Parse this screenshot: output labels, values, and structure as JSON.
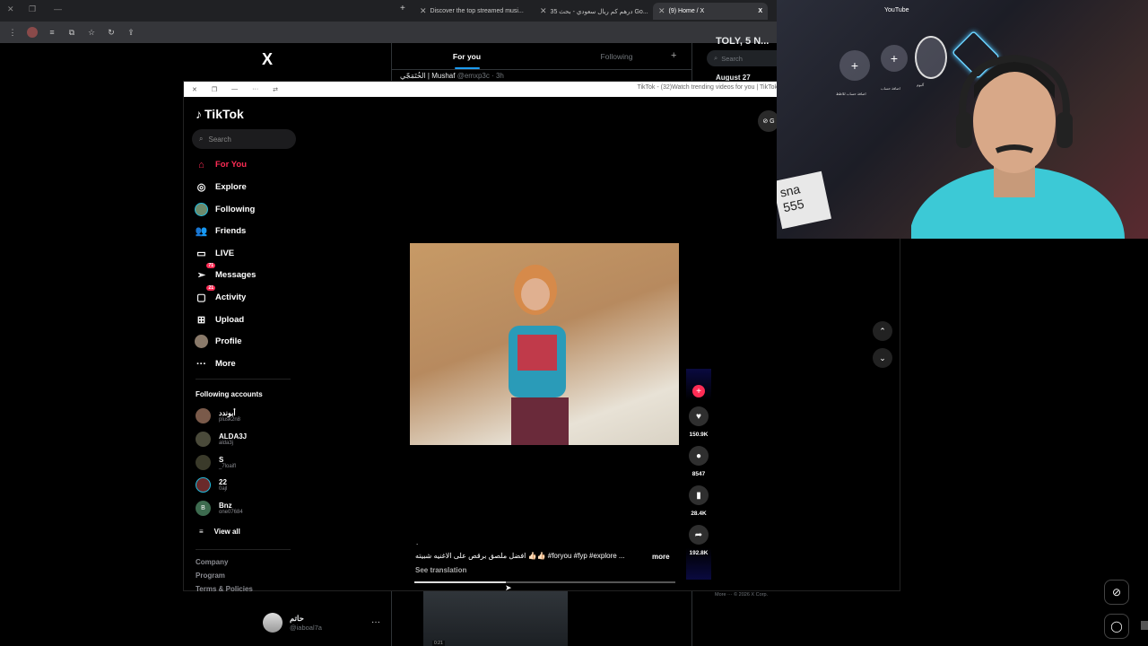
{
  "browser": {
    "tabs": [
      {
        "label": "Discover the top streamed musi...",
        "active": false
      },
      {
        "label": "35 ‎درهم كم ريال سعودي - بحث Go...",
        "active": false
      },
      {
        "label": "(9) Home / X",
        "active": true
      }
    ]
  },
  "x": {
    "logo": "X",
    "tab_for_you": "For you",
    "tab_following": "Following",
    "post_peek_name": "الخُتَمَجّي | Mushaf",
    "post_peek_meta": "@emxp3c · 3h",
    "search_placeholder": "Search",
    "trend_heading": "TOLY, 5 N...",
    "date_label": "August 27",
    "footer": "More ···   © 2026 X Corp.",
    "account_name": "حاتم",
    "account_handle": "@iaboal7a",
    "thumb_label": "0:21"
  },
  "tiktok": {
    "window_title": "TikTok - (32)Watch trending videos for you | TikTok",
    "logo": "TikTok",
    "search_placeholder": "Search",
    "nav": [
      {
        "label": "For You",
        "icon": "home-icon",
        "active": true
      },
      {
        "label": "Explore",
        "icon": "compass-icon"
      },
      {
        "label": "Following",
        "icon": "following-avatar-icon"
      },
      {
        "label": "Friends",
        "icon": "friends-icon"
      },
      {
        "label": "LIVE",
        "icon": "live-icon"
      },
      {
        "label": "Messages",
        "icon": "messages-icon",
        "badge": "71"
      },
      {
        "label": "Activity",
        "icon": "activity-icon",
        "badge": "21"
      },
      {
        "label": "Upload",
        "icon": "upload-icon"
      },
      {
        "label": "Profile",
        "icon": "profile-avatar-icon"
      },
      {
        "label": "More",
        "icon": "more-icon"
      }
    ],
    "following_header": "Following accounts",
    "accounts": [
      {
        "name": "أبوندد",
        "handle": "plusk2n8"
      },
      {
        "name": "ALDA3J",
        "handle": "alda3j"
      },
      {
        "name": "S",
        "handle": "_7loaifl"
      },
      {
        "name": "22",
        "handle": "0ajl"
      },
      {
        "name": "Bnz",
        "handle": "one07684",
        "initial": "B"
      }
    ],
    "view_all": "View all",
    "footer_links": [
      "Company",
      "Program",
      "Terms & Policies"
    ],
    "caption_dot": ".",
    "caption": "افضل ملصق برقص على الاغنيه شبيته 👍🏻👍🏻 #foryou #fyp #explore ...",
    "caption_more": "more",
    "see_translation": "See translation",
    "progress": 0.35,
    "likes": "150.9K",
    "comments": "8547",
    "saves": "28.4K",
    "shares": "192.8K",
    "corner_button": "⊘ G"
  },
  "webcam": {
    "yt_label": "YouTube",
    "plate_text": "sna\n555",
    "labels": [
      "اضافة حساب للاظظ",
      "اضافة حساب",
      "آلبوم"
    ]
  }
}
